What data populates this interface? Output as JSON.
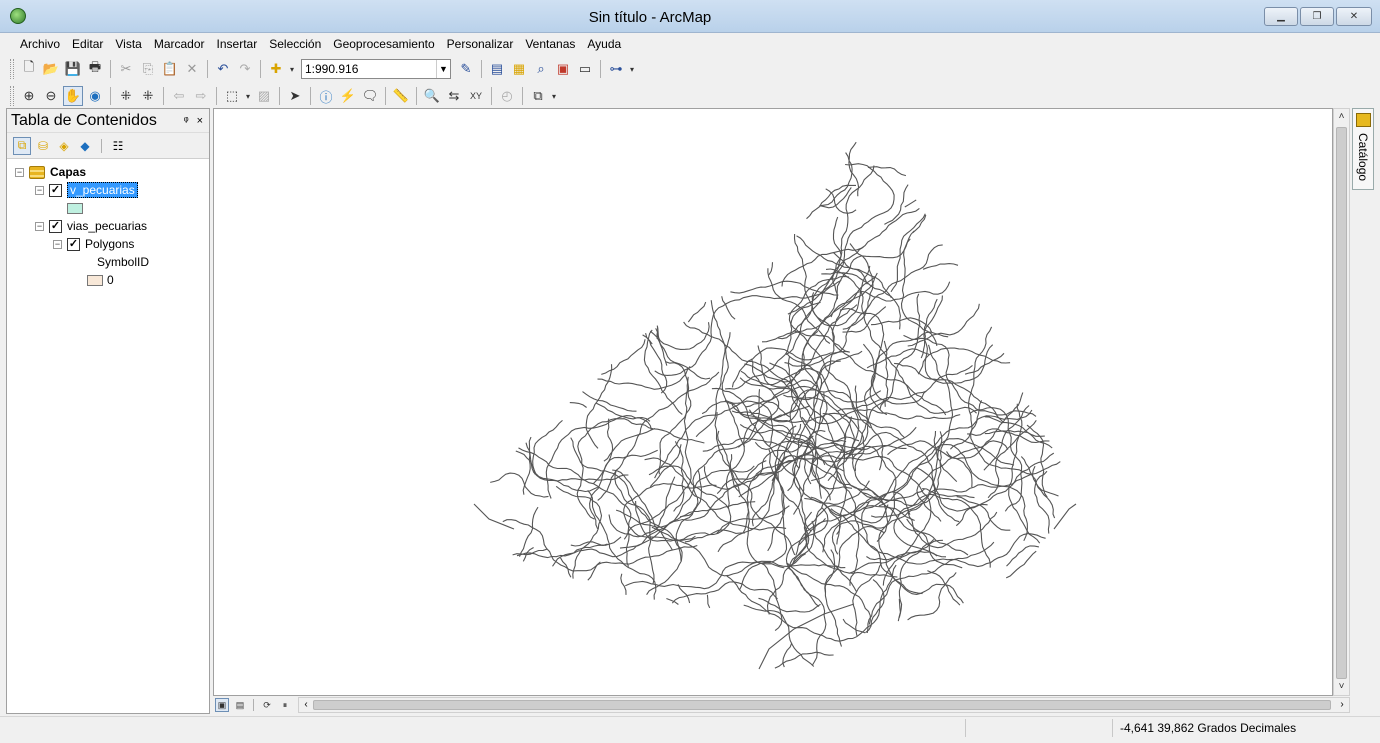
{
  "window": {
    "title": "Sin título - ArcMap",
    "minimize_icon": "minimize-icon",
    "restore_icon": "restore-icon",
    "close_icon": "close-icon"
  },
  "menu": [
    "Archivo",
    "Editar",
    "Vista",
    "Marcador",
    "Insertar",
    "Selección",
    "Geoprocesamiento",
    "Personalizar",
    "Ventanas",
    "Ayuda"
  ],
  "toolbar1": {
    "scale_value": "1:990.916",
    "icons": [
      "new-document-icon",
      "open-icon",
      "save-icon",
      "print-icon",
      "cut-icon",
      "copy-icon",
      "paste-icon",
      "delete-icon",
      "undo-icon",
      "redo-icon",
      "add-data-icon",
      "editor-icon",
      "table-icon",
      "catalog-icon",
      "search-icon",
      "arctoolbox-icon",
      "python-icon",
      "model-builder-icon"
    ]
  },
  "toolbar2": {
    "icons": [
      "zoom-in-icon",
      "zoom-out-icon",
      "pan-icon",
      "full-extent-icon",
      "fixed-zoom-in-icon",
      "fixed-zoom-out-icon",
      "back-icon",
      "forward-icon",
      "select-features-icon",
      "clear-selection-icon",
      "select-elements-icon",
      "identify-icon",
      "hyperlink-icon",
      "html-popup-icon",
      "measure-icon",
      "find-icon",
      "find-route-icon",
      "go-to-xy-icon",
      "time-slider-icon",
      "create-viewer-icon"
    ]
  },
  "toc": {
    "title": "Tabla de Contenidos",
    "pin_label": "ᵠ",
    "close_label": "×",
    "tree": {
      "root": "Capas",
      "layer1": "v_pecuarias",
      "layer2": "vias_pecuarias",
      "sublayer": "Polygons",
      "field": "SymbolID",
      "class_value": "0"
    },
    "colors": {
      "layer1_swatch": "#bff0e0",
      "layer2_swatch": "#f8e8d8",
      "selection": "#3399ff"
    }
  },
  "side_panel": {
    "catalog_label": "Catálogo"
  },
  "status": {
    "coordinates": "-4,641  39,862 Grados Decimales"
  }
}
